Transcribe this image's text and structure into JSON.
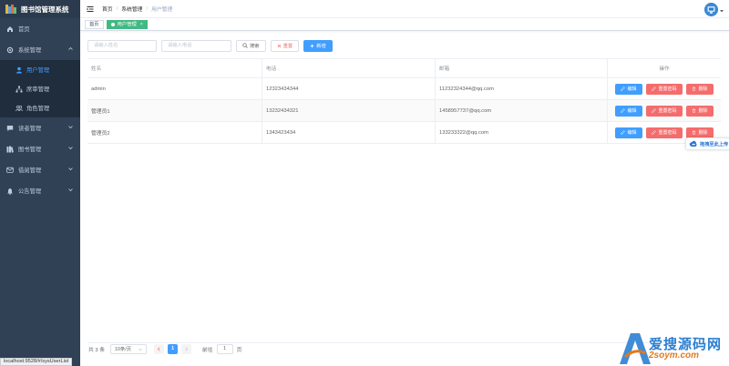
{
  "app": {
    "title": "图书馆管理系统"
  },
  "sidebar": {
    "items": [
      {
        "label": "首页",
        "icon": "dashboard-icon"
      },
      {
        "label": "系统管理",
        "icon": "gear-icon",
        "expanded": true,
        "children": [
          {
            "label": "用户管理",
            "icon": "user-icon",
            "active": true
          },
          {
            "label": "席审管理",
            "icon": "tree-icon"
          },
          {
            "label": "角色管理",
            "icon": "peoples-icon"
          }
        ]
      },
      {
        "label": "读者管理",
        "icon": "chat-icon"
      },
      {
        "label": "图书管理",
        "icon": "books-icon"
      },
      {
        "label": "借阅管理",
        "icon": "message-icon"
      },
      {
        "label": "公告管理",
        "icon": "bell-icon"
      }
    ]
  },
  "header": {
    "breadcrumb": [
      "首页",
      "系统管理",
      "用户管理"
    ]
  },
  "tags": [
    {
      "label": "首页",
      "active": false
    },
    {
      "label": "用户管理",
      "active": true
    }
  ],
  "search": {
    "name_placeholder": "请输入姓名",
    "phone_placeholder": "请输入电话",
    "search_label": "搜索",
    "reset_label": "重置",
    "add_label": "新增"
  },
  "table": {
    "columns": [
      "姓名",
      "电话",
      "邮箱",
      "操作"
    ],
    "rows": [
      {
        "name": "admin",
        "phone": "12323434344",
        "email": "11232324344@qq.com"
      },
      {
        "name": "管理员1",
        "phone": "13232434321",
        "email": "1458957737@qq.com"
      },
      {
        "name": "管理员2",
        "phone": "1343423434",
        "email": "133233322@qq.com"
      }
    ],
    "actions": {
      "edit": "编辑",
      "reset_pwd": "重置密码",
      "delete": "删除"
    }
  },
  "pagination": {
    "total_text": "共 3 条",
    "page_size": "10条/页",
    "current_page": "1",
    "goto_label": "前往",
    "goto_value": "1",
    "page_suffix": "页"
  },
  "float_widget": {
    "label": "拖拽至此上传"
  },
  "status_bar": {
    "url": "localhost:9528/#/sysUserList"
  },
  "watermark": {
    "line1": "爱搜源码网",
    "line2": "2soym.com"
  },
  "colors": {
    "sidebar": "#304156",
    "primary": "#409eff",
    "danger": "#f56c6c",
    "tag_active": "#42b983"
  }
}
